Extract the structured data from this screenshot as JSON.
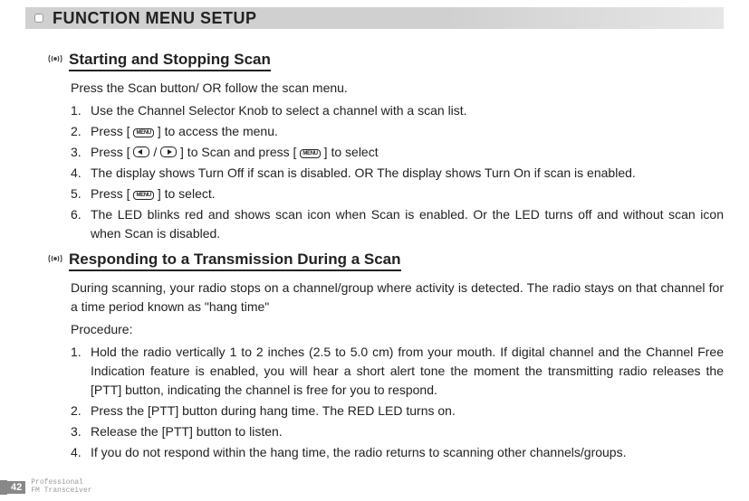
{
  "titlebar": "FUNCTION MENU SETUP",
  "section1": {
    "title": "Starting and Stopping Scan",
    "intro": "Press the Scan button/ OR follow the scan menu.",
    "items": {
      "i1": "Use the Channel Selector Knob to select a channel with a scan list.",
      "i2a": "Press [ ",
      "i2b": " ] to access the menu.",
      "i3a": "Press [ ",
      "i3b": " / ",
      "i3c": " ] to Scan and press [ ",
      "i3d": " ] to select",
      "i4": "The display shows Turn Off if scan is disabled. OR The display shows Turn On if scan is enabled.",
      "i5a": "Press [ ",
      "i5b": " ] to select.",
      "i6": "The LED blinks red and shows scan icon when Scan is enabled. Or the LED turns off and without scan icon when Scan is disabled."
    }
  },
  "section2": {
    "title": "Responding to a Transmission During a Scan",
    "intro1": "During scanning, your radio stops on a channel/group where  activity  is  detected.  The  radio  stays on  that channel for a time period known as \"hang time\"",
    "intro2": "Procedure:",
    "items": {
      "i1": "Hold the radio vertically 1 to 2 inches (2.5 to 5.0 cm) from your mouth. If digital  channel and the Channel  Free  Indication feature is enabled, you will hear a short alert tone the moment the  transmitting  radio  releases  the  [PTT] button,  indicating  the  channel  is  free  for  you  to respond.",
      "i2": "Press the [PTT] button during hang time. The RED LED turns on.",
      "i3": "Release the [PTT] button to listen.",
      "i4": "If you do not respond within the hang time, the radio returns to scanning other channels/groups."
    }
  },
  "footer": {
    "page": "42",
    "line1": "Professional",
    "line2": "FM Transceiver"
  },
  "icons": {
    "menu": "MENU"
  }
}
